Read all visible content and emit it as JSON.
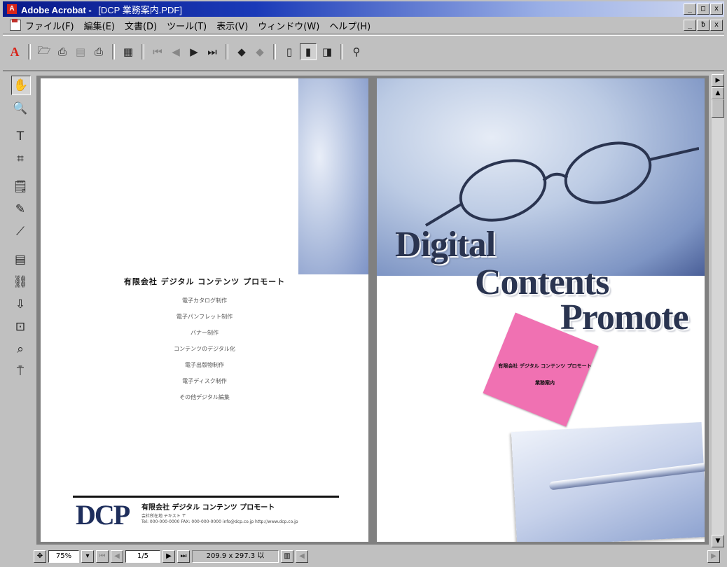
{
  "window": {
    "app_name": "Adobe Acrobat",
    "separator": "-",
    "doc_title": "[DCP 業務案内.PDF]",
    "min": "_",
    "max": "□",
    "close": "x",
    "restore": "ƀ"
  },
  "menu": {
    "items": [
      "ファイル(F)",
      "編集(E)",
      "文書(D)",
      "ツール(T)",
      "表示(V)",
      "ウィンドウ(W)",
      "ヘルプ(H)"
    ]
  },
  "toolbar": {
    "logo": "A",
    "buttons": [
      {
        "name": "open-icon",
        "glyph": "🗁"
      },
      {
        "name": "print-setup-icon",
        "glyph": "⎙"
      },
      {
        "name": "save-icon",
        "glyph": "▤"
      },
      {
        "name": "print-icon",
        "glyph": "⎙"
      },
      {
        "name": "thumbnails-icon",
        "glyph": "▦"
      },
      {
        "name": "first-page-icon",
        "glyph": "⏮"
      },
      {
        "name": "prev-page-icon",
        "glyph": "◀"
      },
      {
        "name": "next-page-icon",
        "glyph": "▶"
      },
      {
        "name": "last-page-icon",
        "glyph": "⏭"
      },
      {
        "name": "go-back-icon",
        "glyph": "◆"
      },
      {
        "name": "go-forward-icon",
        "glyph": "◆"
      },
      {
        "name": "single-page-icon",
        "glyph": "▯"
      },
      {
        "name": "continuous-page-icon",
        "glyph": "▮"
      },
      {
        "name": "facing-pages-icon",
        "glyph": "◨"
      },
      {
        "name": "find-icon",
        "glyph": "⚲"
      }
    ]
  },
  "tools": [
    {
      "name": "hand-tool-icon",
      "glyph": "✋"
    },
    {
      "name": "zoom-tool-icon",
      "glyph": "🔍"
    },
    {
      "name": "text-select-tool-icon",
      "glyph": "T"
    },
    {
      "name": "crop-tool-icon",
      "glyph": "⌗"
    },
    {
      "name": "note-tool-icon",
      "glyph": "🗒"
    },
    {
      "name": "pencil-tool-icon",
      "glyph": "✎"
    },
    {
      "name": "highlight-tool-icon",
      "glyph": "⟋"
    },
    {
      "name": "form-tool-icon",
      "glyph": "▤"
    },
    {
      "name": "link-tool-icon",
      "glyph": "⛓"
    },
    {
      "name": "article-tool-icon",
      "glyph": "⇩"
    },
    {
      "name": "movie-tool-icon",
      "glyph": "⊡"
    },
    {
      "name": "touchup-tool-icon",
      "glyph": "⌕"
    },
    {
      "name": "stamp-tool-icon",
      "glyph": "⍑"
    }
  ],
  "left_page": {
    "company": "有限会社 デジタル コンテンツ プロモート",
    "services": [
      "電子カタログ制作",
      "電子パンフレット制作",
      "バナー制作",
      "コンテンツのデジタル化",
      "電子出版物制作",
      "電子ディスク制作",
      "その他デジタル編集"
    ],
    "logo": "DCP",
    "footer_company": "有限会社 デジタル コンテンツ プロモート",
    "footer_address": "会社所在地 テキスト 〒",
    "footer_contact": "Tel: 000-000-0000  FAX: 000-000-0000  info@dcp.co.jp  http://www.dcp.co.jp"
  },
  "right_page": {
    "headline_1": "Digital",
    "headline_2": "Contents",
    "headline_3": "Promote",
    "pink_line_1": "有限会社 デジタル コンテンツ プロモート",
    "pink_line_2": "業務案内"
  },
  "status": {
    "zoom": "75%",
    "page": "1/5",
    "page_size": "209.9 x 297.3 以"
  },
  "scrollbar": {
    "up": "▲",
    "down": "▼",
    "right_arrow": "▶"
  }
}
